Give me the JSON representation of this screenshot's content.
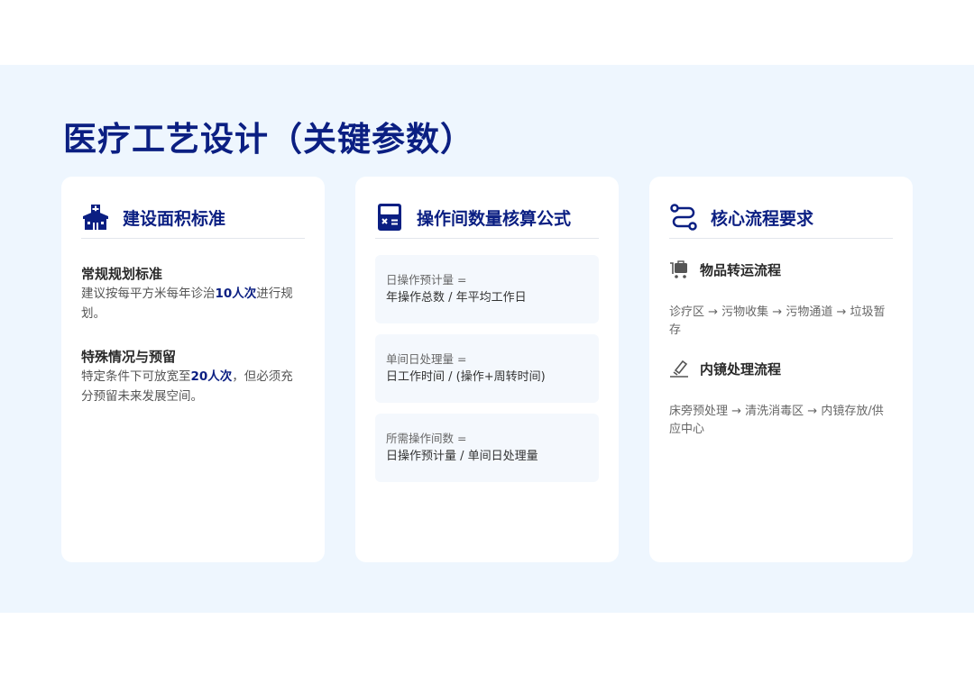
{
  "page": {
    "title": "医疗工艺设计（关键参数）"
  },
  "colors": {
    "accent": "#0b1f82",
    "band_background": "#eef6fe",
    "card_background": "#ffffff",
    "formula_background": "#f4f8fd"
  },
  "cards": [
    {
      "title": "建设面积标准",
      "icon": "hospital-icon",
      "blocks": [
        {
          "heading": "常规规划标准",
          "text_before": "建议按每平方米每年诊治",
          "highlight": "10人次",
          "text_after": "进行规划。"
        },
        {
          "heading": "特殊情况与预留",
          "text_before": "特定条件下可放宽至",
          "highlight": "20人次",
          "text_after": "，但必须充分预留未来发展空间。"
        }
      ]
    },
    {
      "title": "操作间数量核算公式",
      "icon": "calculator-icon",
      "formulas": [
        {
          "label": "日操作预计量 =",
          "expr": "年操作总数 / 年平均工作日"
        },
        {
          "label": "单间日处理量 =",
          "expr": "日工作时间 / (操作+周转时间)"
        },
        {
          "label": "所需操作间数 =",
          "expr": "日操作预计量 / 单间日处理量"
        }
      ]
    },
    {
      "title": "核心流程要求",
      "icon": "route-icon",
      "flows": [
        {
          "title": "物品转运流程",
          "icon": "cart-icon",
          "text": "诊疗区 → 污物收集 → 污物通道 → 垃圾暂存"
        },
        {
          "title": "内镜处理流程",
          "icon": "sanitize-icon",
          "text": "床旁预处理 → 清洗消毒区 → 内镜存放/供应中心"
        }
      ]
    }
  ]
}
